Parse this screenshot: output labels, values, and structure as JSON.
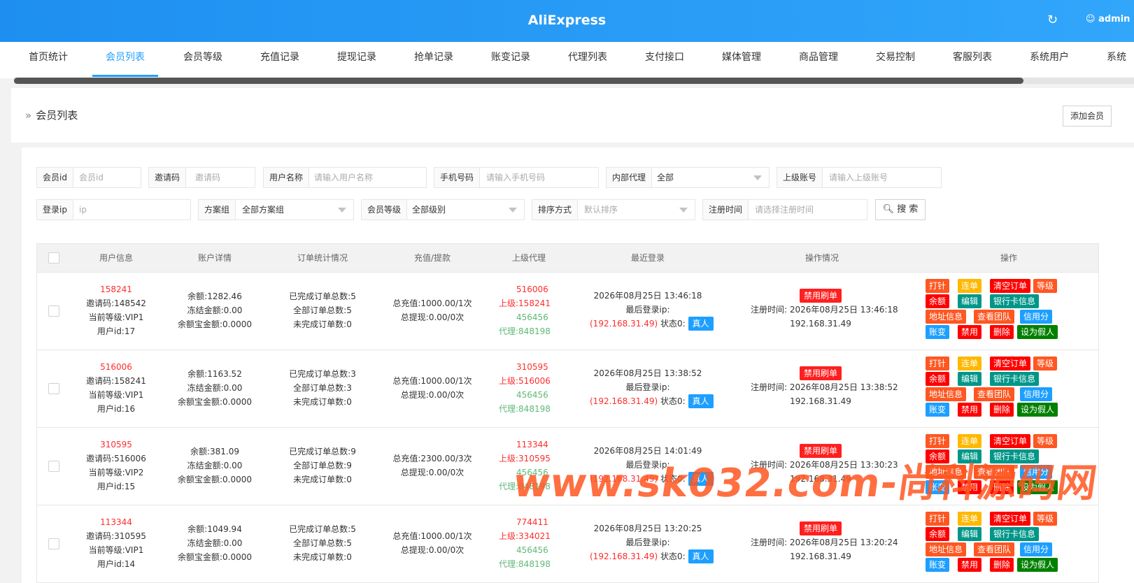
{
  "header": {
    "title": "AliExpress",
    "user": "admin"
  },
  "tabs": [
    "首页统计",
    "会员列表",
    "会员等级",
    "充值记录",
    "提现记录",
    "抢单记录",
    "账变记录",
    "代理列表",
    "支付接口",
    "媒体管理",
    "商品管理",
    "交易控制",
    "客服列表",
    "系统用户",
    "系统"
  ],
  "page": {
    "breadcrumb": "会员列表",
    "add_button": "添加会员"
  },
  "filters": {
    "member_id": {
      "label": "会员id",
      "placeholder": "会员id"
    },
    "invite": {
      "label": "邀请码",
      "placeholder": "邀请码"
    },
    "username": {
      "label": "用户名称",
      "placeholder": "请输入用户名称"
    },
    "phone": {
      "label": "手机号码",
      "placeholder": "请输入手机号码"
    },
    "agent": {
      "label": "内部代理",
      "value": "全部"
    },
    "parent": {
      "label": "上级账号",
      "placeholder": "请输入上级账号"
    },
    "ip": {
      "label": "登录ip",
      "placeholder": "ip"
    },
    "plan": {
      "label": "方案组",
      "value": "全部方案组"
    },
    "level": {
      "label": "会员等级",
      "value": "全部级别"
    },
    "sort": {
      "label": "排序方式",
      "placeholder": "默认排序"
    },
    "regtime": {
      "label": "注册时间",
      "placeholder": "请选择注册时间"
    },
    "search": "搜 索"
  },
  "columns": [
    "用户信息",
    "账户详情",
    "订单统计情况",
    "充值/提款",
    "上级代理",
    "最近登录",
    "操作情况",
    "操作"
  ],
  "labels": {
    "invite": "邀请码:",
    "level": "当前等级:",
    "uid": "用户id:",
    "balance": "余额:",
    "frozen": "冻结金额:",
    "yeb": "余额宝金额:",
    "done": "已完成订单总数:",
    "total": "全部订单总数:",
    "undone": "未完成订单数:",
    "recharge": "总充值:",
    "withdraw": "总提现:",
    "parent": "上级:",
    "agent": "代理:",
    "last_ip": "最后登录ip:",
    "status": "状态0:",
    "real": "真人",
    "ban_brush": "禁用刷单",
    "reg_time": "注册时间:"
  },
  "ops": [
    "打针",
    "连单",
    "清空订单",
    "等级",
    "余额",
    "编辑",
    "银行卡信息",
    "地址信息",
    "查看团队",
    "信用分",
    "账变",
    "禁用",
    "删除",
    "设为假人"
  ],
  "rows": [
    {
      "id": "158241",
      "invite": "148542",
      "level": "VIP1",
      "uid": "17",
      "balance": "1282.46",
      "frozen": "0.00",
      "yeb": "0.0000",
      "done": "5",
      "total": "5",
      "undone": "0",
      "recharge": "1000.00/1次",
      "withdraw": "0.00/0次",
      "parent1": "516006",
      "parent2": "158241",
      "agent1": "456456",
      "agent2": "848198",
      "login_time": "2026年08月25日 13:46:18",
      "ip": "(192.168.31.49)",
      "reg_time": "2026年08月25日 13:46:18",
      "reg_ip": "192.168.31.49"
    },
    {
      "id": "516006",
      "invite": "158241",
      "level": "VIP1",
      "uid": "16",
      "balance": "1163.52",
      "frozen": "0.00",
      "yeb": "0.0000",
      "done": "3",
      "total": "3",
      "undone": "0",
      "recharge": "1000.00/1次",
      "withdraw": "0.00/0次",
      "parent1": "310595",
      "parent2": "516006",
      "agent1": "456456",
      "agent2": "848198",
      "login_time": "2026年08月25日 13:38:52",
      "ip": "(192.168.31.49)",
      "reg_time": "2026年08月25日 13:38:52",
      "reg_ip": "192.168.31.49"
    },
    {
      "id": "310595",
      "invite": "516006",
      "level": "VIP2",
      "uid": "15",
      "balance": "381.09",
      "frozen": "0.00",
      "yeb": "0.0000",
      "done": "9",
      "total": "9",
      "undone": "0",
      "recharge": "2300.00/3次",
      "withdraw": "0.00/0次",
      "parent1": "113344",
      "parent2": "310595",
      "agent1": "456456",
      "agent2": "848198",
      "login_time": "2026年08月25日 14:01:49",
      "ip": "(192.168.31.49)",
      "reg_time": "2026年08月25日 13:30:23",
      "reg_ip": "192.168.31.49"
    },
    {
      "id": "113344",
      "invite": "310595",
      "level": "VIP1",
      "uid": "14",
      "balance": "1049.94",
      "frozen": "0.00",
      "yeb": "0.0000",
      "done": "5",
      "total": "5",
      "undone": "0",
      "recharge": "1000.00/1次",
      "withdraw": "0.00/0次",
      "parent1": "774411",
      "parent2": "334021",
      "agent1": "456456",
      "agent2": "848198",
      "login_time": "2026年08月25日 13:20:25",
      "ip": "(192.168.31.49)",
      "reg_time": "2026年08月25日 13:20:24",
      "reg_ip": "192.168.31.49"
    }
  ],
  "watermark": "www.sk032.com-尚科源码网"
}
